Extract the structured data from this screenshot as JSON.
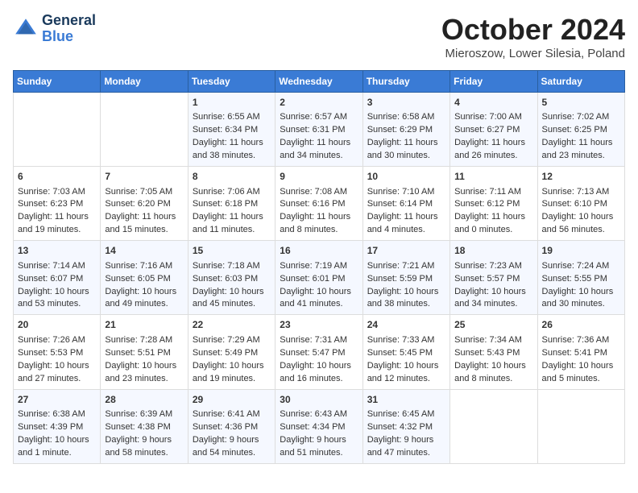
{
  "header": {
    "logo_line1": "General",
    "logo_line2": "Blue",
    "month": "October 2024",
    "location": "Mieroszow, Lower Silesia, Poland"
  },
  "weekdays": [
    "Sunday",
    "Monday",
    "Tuesday",
    "Wednesday",
    "Thursday",
    "Friday",
    "Saturday"
  ],
  "weeks": [
    [
      {
        "day": "",
        "content": ""
      },
      {
        "day": "",
        "content": ""
      },
      {
        "day": "1",
        "content": "Sunrise: 6:55 AM\nSunset: 6:34 PM\nDaylight: 11 hours\nand 38 minutes."
      },
      {
        "day": "2",
        "content": "Sunrise: 6:57 AM\nSunset: 6:31 PM\nDaylight: 11 hours\nand 34 minutes."
      },
      {
        "day": "3",
        "content": "Sunrise: 6:58 AM\nSunset: 6:29 PM\nDaylight: 11 hours\nand 30 minutes."
      },
      {
        "day": "4",
        "content": "Sunrise: 7:00 AM\nSunset: 6:27 PM\nDaylight: 11 hours\nand 26 minutes."
      },
      {
        "day": "5",
        "content": "Sunrise: 7:02 AM\nSunset: 6:25 PM\nDaylight: 11 hours\nand 23 minutes."
      }
    ],
    [
      {
        "day": "6",
        "content": "Sunrise: 7:03 AM\nSunset: 6:23 PM\nDaylight: 11 hours\nand 19 minutes."
      },
      {
        "day": "7",
        "content": "Sunrise: 7:05 AM\nSunset: 6:20 PM\nDaylight: 11 hours\nand 15 minutes."
      },
      {
        "day": "8",
        "content": "Sunrise: 7:06 AM\nSunset: 6:18 PM\nDaylight: 11 hours\nand 11 minutes."
      },
      {
        "day": "9",
        "content": "Sunrise: 7:08 AM\nSunset: 6:16 PM\nDaylight: 11 hours\nand 8 minutes."
      },
      {
        "day": "10",
        "content": "Sunrise: 7:10 AM\nSunset: 6:14 PM\nDaylight: 11 hours\nand 4 minutes."
      },
      {
        "day": "11",
        "content": "Sunrise: 7:11 AM\nSunset: 6:12 PM\nDaylight: 11 hours\nand 0 minutes."
      },
      {
        "day": "12",
        "content": "Sunrise: 7:13 AM\nSunset: 6:10 PM\nDaylight: 10 hours\nand 56 minutes."
      }
    ],
    [
      {
        "day": "13",
        "content": "Sunrise: 7:14 AM\nSunset: 6:07 PM\nDaylight: 10 hours\nand 53 minutes."
      },
      {
        "day": "14",
        "content": "Sunrise: 7:16 AM\nSunset: 6:05 PM\nDaylight: 10 hours\nand 49 minutes."
      },
      {
        "day": "15",
        "content": "Sunrise: 7:18 AM\nSunset: 6:03 PM\nDaylight: 10 hours\nand 45 minutes."
      },
      {
        "day": "16",
        "content": "Sunrise: 7:19 AM\nSunset: 6:01 PM\nDaylight: 10 hours\nand 41 minutes."
      },
      {
        "day": "17",
        "content": "Sunrise: 7:21 AM\nSunset: 5:59 PM\nDaylight: 10 hours\nand 38 minutes."
      },
      {
        "day": "18",
        "content": "Sunrise: 7:23 AM\nSunset: 5:57 PM\nDaylight: 10 hours\nand 34 minutes."
      },
      {
        "day": "19",
        "content": "Sunrise: 7:24 AM\nSunset: 5:55 PM\nDaylight: 10 hours\nand 30 minutes."
      }
    ],
    [
      {
        "day": "20",
        "content": "Sunrise: 7:26 AM\nSunset: 5:53 PM\nDaylight: 10 hours\nand 27 minutes."
      },
      {
        "day": "21",
        "content": "Sunrise: 7:28 AM\nSunset: 5:51 PM\nDaylight: 10 hours\nand 23 minutes."
      },
      {
        "day": "22",
        "content": "Sunrise: 7:29 AM\nSunset: 5:49 PM\nDaylight: 10 hours\nand 19 minutes."
      },
      {
        "day": "23",
        "content": "Sunrise: 7:31 AM\nSunset: 5:47 PM\nDaylight: 10 hours\nand 16 minutes."
      },
      {
        "day": "24",
        "content": "Sunrise: 7:33 AM\nSunset: 5:45 PM\nDaylight: 10 hours\nand 12 minutes."
      },
      {
        "day": "25",
        "content": "Sunrise: 7:34 AM\nSunset: 5:43 PM\nDaylight: 10 hours\nand 8 minutes."
      },
      {
        "day": "26",
        "content": "Sunrise: 7:36 AM\nSunset: 5:41 PM\nDaylight: 10 hours\nand 5 minutes."
      }
    ],
    [
      {
        "day": "27",
        "content": "Sunrise: 6:38 AM\nSunset: 4:39 PM\nDaylight: 10 hours\nand 1 minute."
      },
      {
        "day": "28",
        "content": "Sunrise: 6:39 AM\nSunset: 4:38 PM\nDaylight: 9 hours\nand 58 minutes."
      },
      {
        "day": "29",
        "content": "Sunrise: 6:41 AM\nSunset: 4:36 PM\nDaylight: 9 hours\nand 54 minutes."
      },
      {
        "day": "30",
        "content": "Sunrise: 6:43 AM\nSunset: 4:34 PM\nDaylight: 9 hours\nand 51 minutes."
      },
      {
        "day": "31",
        "content": "Sunrise: 6:45 AM\nSunset: 4:32 PM\nDaylight: 9 hours\nand 47 minutes."
      },
      {
        "day": "",
        "content": ""
      },
      {
        "day": "",
        "content": ""
      }
    ]
  ]
}
